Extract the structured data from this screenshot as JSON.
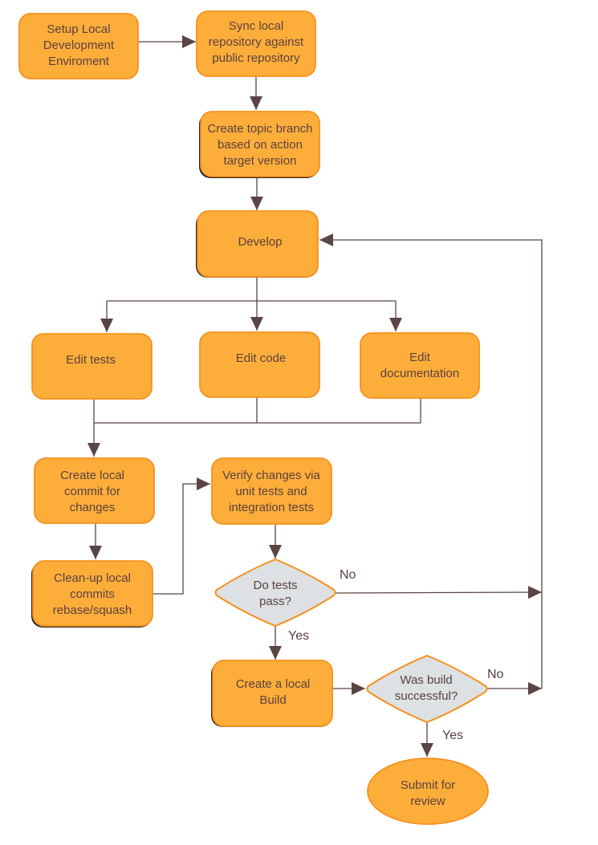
{
  "nodes": {
    "setup": [
      "Setup Local",
      "Development",
      "Enviroment"
    ],
    "sync": [
      "Sync local",
      "repository against",
      "public repository"
    ],
    "topic": [
      "Create topic branch",
      "based on action",
      "target version"
    ],
    "develop": [
      "Develop"
    ],
    "edit_tests": [
      "Edit tests"
    ],
    "edit_code": [
      "Edit code"
    ],
    "edit_docs": [
      "Edit",
      "documentation"
    ],
    "commit": [
      "Create local",
      "commit for",
      "changes"
    ],
    "cleanup": [
      "Clean-up local",
      "commits",
      "rebase/squash"
    ],
    "verify": [
      "Verify changes via",
      "unit tests and",
      "integration tests"
    ],
    "tests_pass": [
      "Do tests",
      "pass?"
    ],
    "build": [
      "Create a local",
      "Build"
    ],
    "build_ok": [
      "Was build",
      "successful?"
    ],
    "submit": [
      "Submit for",
      "review"
    ]
  },
  "edge_labels": {
    "tests_no": "No",
    "tests_yes": "Yes",
    "build_no": "No",
    "build_yes": "Yes"
  },
  "colors": {
    "process_fill": "#fdae3a",
    "process_border": "#f7901e",
    "decision_fill": "#dde1e3",
    "arrow": "#5b4444",
    "text": "#5b4040"
  }
}
